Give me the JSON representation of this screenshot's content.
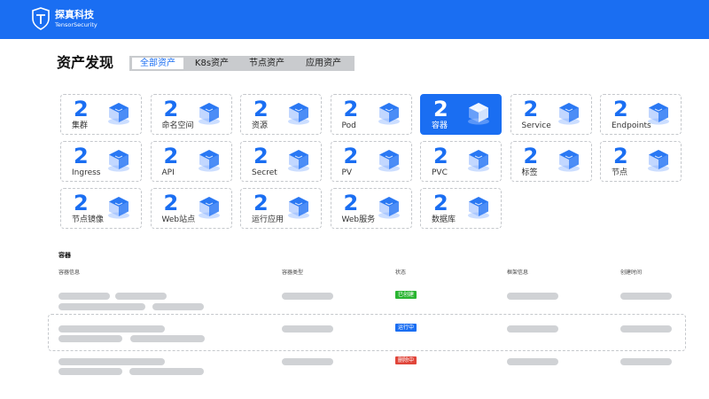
{
  "header": {
    "brand_name": "探真科技",
    "brand_sub": "TensorSecurity",
    "logo_icon": "shield-icon",
    "bar_color": "#1a6ef2"
  },
  "page": {
    "title": "资产发现",
    "tabs": [
      {
        "label": "全部资产",
        "active": true
      },
      {
        "label": "K8s资产",
        "active": false
      },
      {
        "label": "节点资产",
        "active": false
      },
      {
        "label": "应用资产",
        "active": false
      }
    ]
  },
  "cards": [
    {
      "count": "2",
      "label": "集群",
      "icon": "cluster-icon",
      "active": false
    },
    {
      "count": "2",
      "label": "命名空间",
      "icon": "namespace-icon",
      "active": false
    },
    {
      "count": "2",
      "label": "资源",
      "icon": "resource-icon",
      "active": false
    },
    {
      "count": "2",
      "label": "Pod",
      "icon": "pod-icon",
      "active": false
    },
    {
      "count": "2",
      "label": "容器",
      "icon": "container-icon",
      "active": true
    },
    {
      "count": "2",
      "label": "Service",
      "icon": "service-icon",
      "active": false
    },
    {
      "count": "2",
      "label": "Endpoints",
      "icon": "endpoints-icon",
      "active": false
    },
    {
      "count": "2",
      "label": "Ingress",
      "icon": "ingress-icon",
      "active": false
    },
    {
      "count": "2",
      "label": "API",
      "icon": "api-icon",
      "active": false
    },
    {
      "count": "2",
      "label": "Secret",
      "icon": "secret-icon",
      "active": false
    },
    {
      "count": "2",
      "label": "PV",
      "icon": "pv-icon",
      "active": false
    },
    {
      "count": "2",
      "label": "PVC",
      "icon": "pvc-icon",
      "active": false
    },
    {
      "count": "2",
      "label": "标签",
      "icon": "tag-icon",
      "active": false
    },
    {
      "count": "2",
      "label": "节点",
      "icon": "node-icon",
      "active": false
    },
    {
      "count": "2",
      "label": "节点镜像",
      "icon": "node-image-icon",
      "active": false
    },
    {
      "count": "2",
      "label": "Web站点",
      "icon": "web-site-icon",
      "active": false
    },
    {
      "count": "2",
      "label": "运行应用",
      "icon": "running-app-icon",
      "active": false
    },
    {
      "count": "2",
      "label": "Web服务",
      "icon": "web-service-icon",
      "active": false
    },
    {
      "count": "2",
      "label": "数据库",
      "icon": "database-icon",
      "active": false
    }
  ],
  "table": {
    "section_title": "容器",
    "columns": [
      "容器信息",
      "容器类型",
      "状态",
      "框架信息",
      "创建时间"
    ],
    "rows": [
      {
        "status": "已创建",
        "status_color": "#29b530",
        "selected": false
      },
      {
        "status": "运行中",
        "status_color": "#1a6ef2",
        "selected": true
      },
      {
        "status": "删除中",
        "status_color": "#e0453a",
        "selected": false
      }
    ]
  }
}
